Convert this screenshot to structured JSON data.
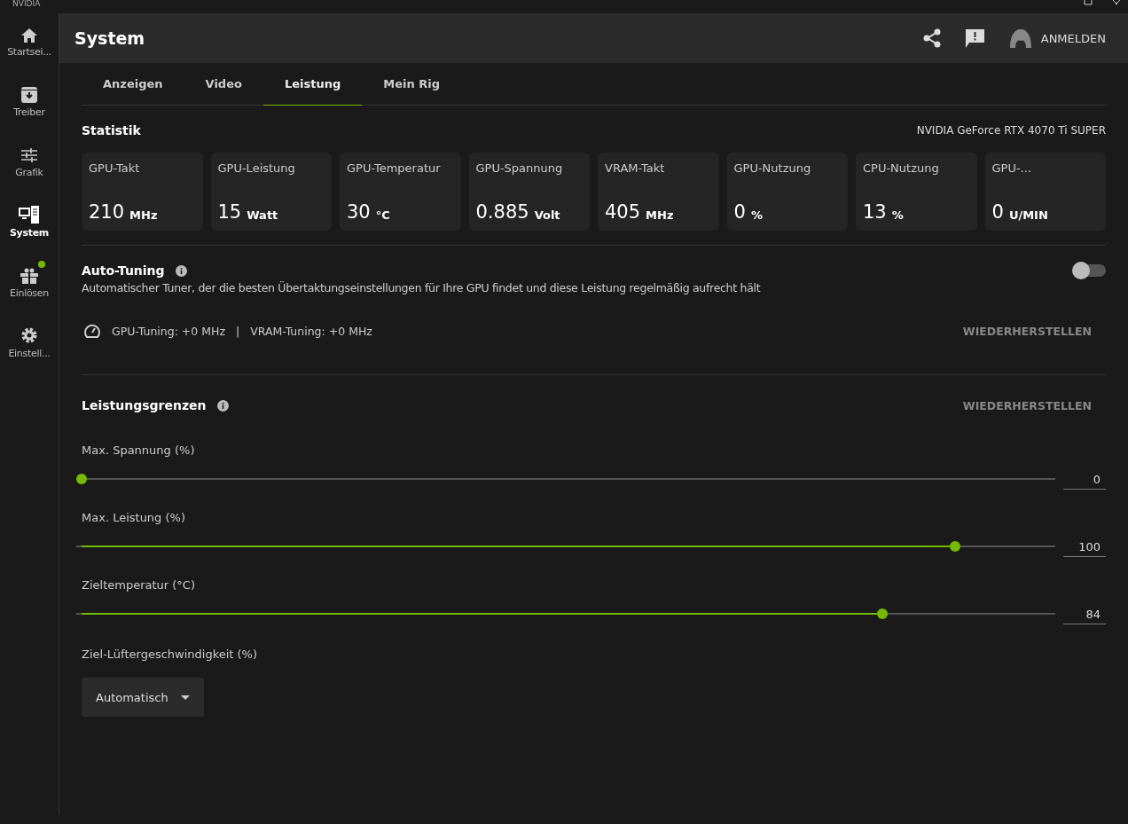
{
  "window": {
    "title": "NVIDIA"
  },
  "sidebar": {
    "items": [
      {
        "label": "Startsei...",
        "selected": false,
        "badge": false
      },
      {
        "label": "Treiber",
        "selected": false,
        "badge": false
      },
      {
        "label": "Grafik",
        "selected": false,
        "badge": false
      },
      {
        "label": "System",
        "selected": true,
        "badge": false
      },
      {
        "label": "Einlösen",
        "selected": false,
        "badge": true
      },
      {
        "label": "Einstell...",
        "selected": false,
        "badge": false
      }
    ]
  },
  "header": {
    "title": "System",
    "sign_in": "ANMELDEN"
  },
  "tabs": [
    {
      "label": "Anzeigen",
      "selected": false
    },
    {
      "label": "Video",
      "selected": false
    },
    {
      "label": "Leistung",
      "selected": true
    },
    {
      "label": "Mein Rig",
      "selected": false
    }
  ],
  "statistics": {
    "title": "Statistik",
    "gpu_name": "NVIDIA GeForce RTX 4070 Ti SUPER",
    "cards": [
      {
        "label": "GPU-Takt",
        "value": "210",
        "unit": "MHz"
      },
      {
        "label": "GPU-Leistung",
        "value": "15",
        "unit": "Watt"
      },
      {
        "label": "GPU-Temperatur",
        "value": "30",
        "unit": "°C"
      },
      {
        "label": "GPU-Spannung",
        "value": "0.885",
        "unit": "Volt"
      },
      {
        "label": "VRAM-Takt",
        "value": "405",
        "unit": "MHz"
      },
      {
        "label": "GPU-Nutzung",
        "value": "0",
        "unit": "%"
      },
      {
        "label": "CPU-Nutzung",
        "value": "13",
        "unit": "%"
      },
      {
        "label": "GPU-...",
        "value": "0",
        "unit": "U/MIN"
      }
    ]
  },
  "auto_tuning": {
    "title": "Auto-Tuning",
    "on": false,
    "description": "Automatischer Tuner, der die besten Übertaktungseinstellungen für Ihre GPU findet und diese Leistung regelmäßig aufrecht hält",
    "gpu_tuning": "GPU-Tuning: +0 MHz",
    "separator": "|",
    "vram_tuning": "VRAM-Tuning: +0 MHz",
    "reset": "WIEDERHERSTELLEN"
  },
  "limits": {
    "title": "Leistungsgrenzen",
    "reset": "WIEDERHERSTELLEN",
    "sliders": [
      {
        "label": "Max. Spannung (%)",
        "level": 0,
        "reading": "0"
      },
      {
        "label": "Max. Leistung (%)",
        "level": 0.902,
        "reading": "100"
      },
      {
        "label": "Zieltemperatur (°C)",
        "level": 0.827,
        "reading": "84"
      }
    ],
    "fan": {
      "label": "Ziel-Lüftergeschwindigkeit (%)",
      "value": "Automatisch"
    }
  }
}
